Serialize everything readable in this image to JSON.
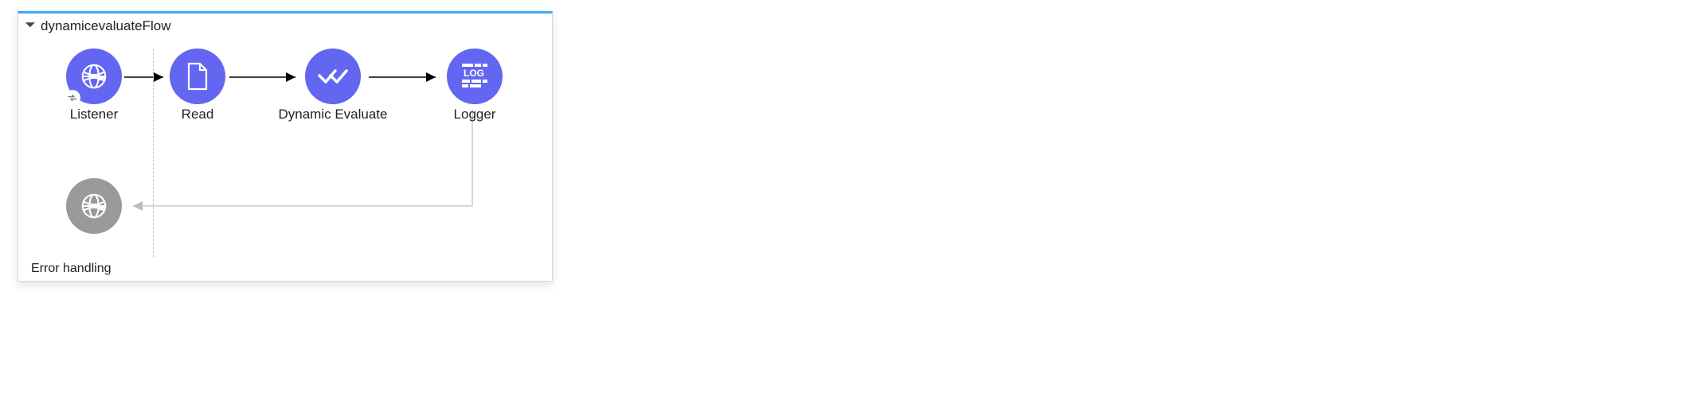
{
  "flow": {
    "title": "dynamicevaluateFlow",
    "error_section": "Error handling",
    "nodes": [
      {
        "id": "listener",
        "label": "Listener"
      },
      {
        "id": "read",
        "label": "Read"
      },
      {
        "id": "dynamic-evaluate",
        "label": "Dynamic Evaluate"
      },
      {
        "id": "logger",
        "label": "Logger",
        "icon_text": "LOG"
      },
      {
        "id": "response",
        "label": ""
      }
    ],
    "colors": {
      "accent": "#6366f1",
      "top_border": "#3fa9f5",
      "disabled": "#9a9a9a"
    }
  }
}
